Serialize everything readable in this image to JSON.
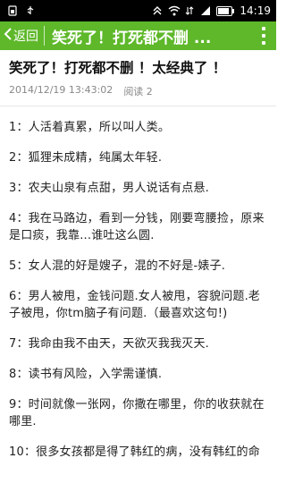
{
  "status_bar": {
    "time": "14:19",
    "icons": [
      "sim-icon",
      "usb-icon",
      "wifi-icon",
      "data-icon",
      "signal-icon",
      "battery-icon"
    ]
  },
  "app_bar": {
    "back_label": "返回",
    "title": "笑死了！打死都不删 ...",
    "colors": {
      "background": "#5eb82a"
    }
  },
  "article": {
    "title": "笑死了！打死都不删 ！太经典了 ！",
    "date": "2014/12/19 13:43:02",
    "reads": "阅读 2",
    "paragraphs": [
      "1：人活着真累，所以叫人类。",
      "2：狐狸未成精，纯属太年轻.",
      "3：农夫山泉有点甜，男人说话有点悬.",
      "4：我在马路边，看到一分钱，刚要弯腰捡，原来是口痰，我靠...谁吐这么圆.",
      "5：女人混的好是嫂子，混的不好是-婊子.",
      "6：男人被甩，金钱问题.女人被甩，容貌问题.老子被甩，你tm脑子有问题.（最喜欢这句!)",
      "7：我命由我不由天，天欲灭我我灭天.",
      "8：读书有风险，入学需谨慎.",
      "9：时间就像一张网，你撒在哪里，你的收获就在哪里.",
      "10：很多女孩都是得了韩红的病，没有韩红的命"
    ]
  }
}
